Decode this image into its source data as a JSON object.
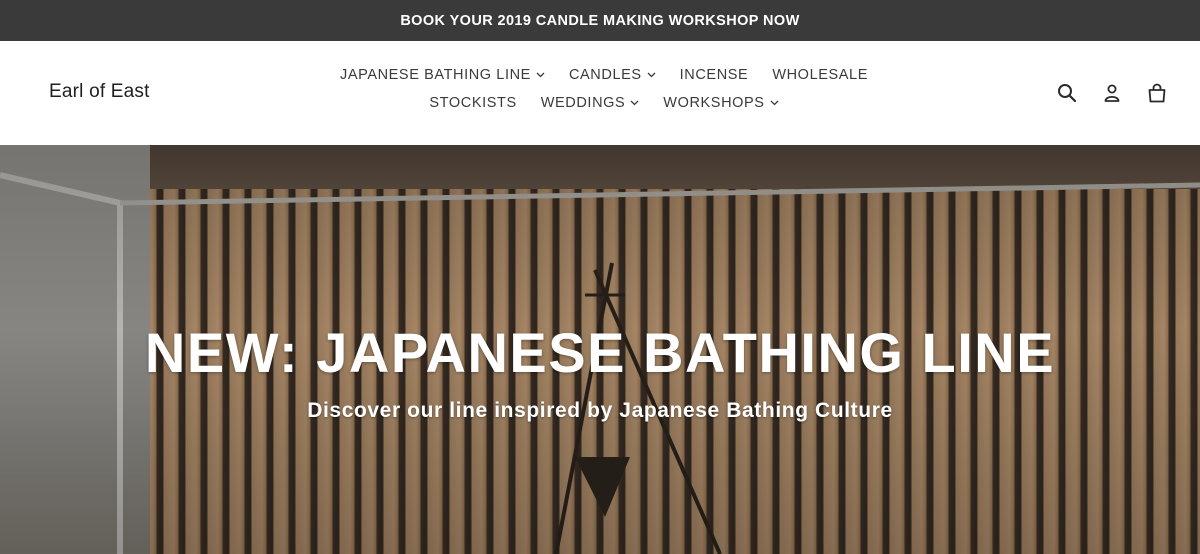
{
  "announcement": {
    "text": "BOOK YOUR 2019 CANDLE MAKING WORKSHOP NOW"
  },
  "header": {
    "logo": "Earl of East",
    "nav_row1": [
      {
        "label": "JAPANESE BATHING LINE",
        "has_dropdown": true
      },
      {
        "label": "CANDLES",
        "has_dropdown": true
      },
      {
        "label": "INCENSE",
        "has_dropdown": false
      },
      {
        "label": "WHOLESALE",
        "has_dropdown": false
      }
    ],
    "nav_row2": [
      {
        "label": "STOCKISTS",
        "has_dropdown": false
      },
      {
        "label": "WEDDINGS",
        "has_dropdown": true
      },
      {
        "label": "WORKSHOPS",
        "has_dropdown": true
      }
    ],
    "icons": [
      "search-icon",
      "account-icon",
      "cart-icon"
    ]
  },
  "hero": {
    "title": "NEW: JAPANESE BATHING LINE",
    "subtitle": "Discover our line inspired by Japanese Bathing Culture"
  },
  "colors": {
    "announcement_bg": "#3a3a3a",
    "text": "#3a3a3a",
    "hero_text": "#ffffff"
  }
}
